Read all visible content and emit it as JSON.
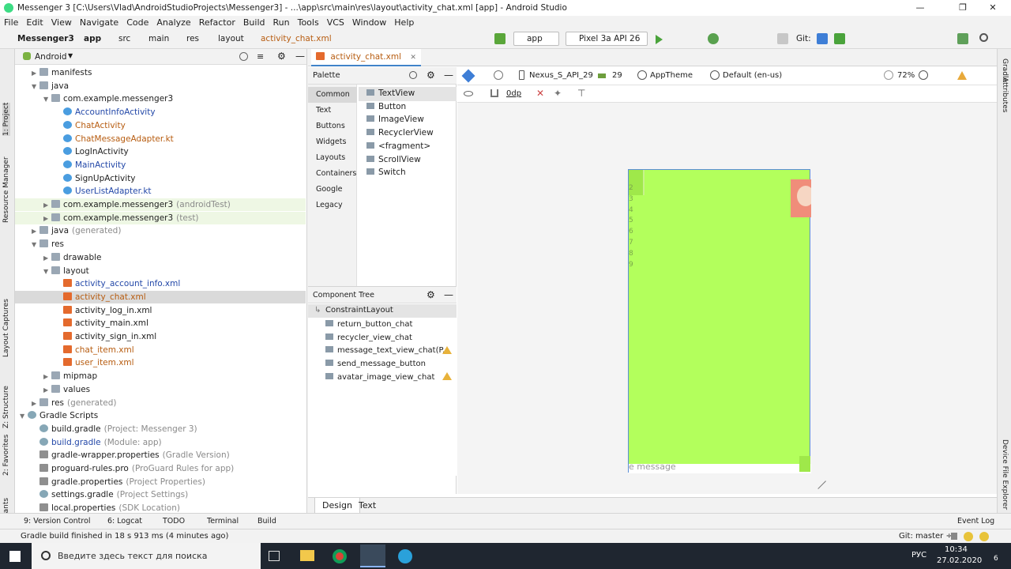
{
  "window": {
    "title": "Messenger 3 [C:\\Users\\Vlad\\AndroidStudioProjects\\Messenger3] - ...\\app\\src\\main\\res\\layout\\activity_chat.xml [app] - Android Studio",
    "minimize": "—",
    "maximize": "❐",
    "close": "✕"
  },
  "menu": [
    "File",
    "Edit",
    "View",
    "Navigate",
    "Code",
    "Analyze",
    "Refactor",
    "Build",
    "Run",
    "Tools",
    "VCS",
    "Window",
    "Help"
  ],
  "breadcrumbs": [
    "Messenger3",
    "app",
    "src",
    "main",
    "res",
    "layout",
    "activity_chat.xml"
  ],
  "toolbar": {
    "run_config": "app",
    "device": "Pixel 3a API 26",
    "git_label": "Git:"
  },
  "left_tabs": [
    "1: Project",
    "Resource Manager",
    "Layout Captures",
    "Z: Structure",
    "2: Favorites",
    "Build Variants"
  ],
  "project": {
    "view": "Android",
    "tree": [
      {
        "label": "manifests",
        "extra": "",
        "style": "normal",
        "icon": "folder-icon",
        "arrow": "▶"
      },
      {
        "label": "java",
        "extra": "",
        "style": "normal",
        "icon": "folder-icon",
        "arrow": "▼"
      },
      {
        "label": "com.example.messenger3",
        "extra": "",
        "style": "normal",
        "icon": "package-icon",
        "arrow": "▼"
      },
      {
        "label": "AccountInfoActivity",
        "extra": "",
        "style": "blue",
        "icon": "class-icon",
        "arrow": ""
      },
      {
        "label": "ChatActivity",
        "extra": "",
        "style": "orange",
        "icon": "class-icon",
        "arrow": ""
      },
      {
        "label": "ChatMessageAdapter.kt",
        "extra": "",
        "style": "orange",
        "icon": "kotlin-file-icon",
        "arrow": ""
      },
      {
        "label": "LogInActivity",
        "extra": "",
        "style": "normal",
        "icon": "class-icon",
        "arrow": ""
      },
      {
        "label": "MainActivity",
        "extra": "",
        "style": "blue",
        "icon": "class-icon",
        "arrow": ""
      },
      {
        "label": "SignUpActivity",
        "extra": "",
        "style": "normal",
        "icon": "class-icon",
        "arrow": ""
      },
      {
        "label": "UserListAdapter.kt",
        "extra": "",
        "style": "blue",
        "icon": "kotlin-file-icon",
        "arrow": ""
      },
      {
        "label": "com.example.messenger3",
        "extra": "(androidTest)",
        "style": "normal",
        "icon": "package-icon",
        "arrow": "▶"
      },
      {
        "label": "com.example.messenger3",
        "extra": "(test)",
        "style": "normal",
        "icon": "package-icon",
        "arrow": "▶"
      },
      {
        "label": "java",
        "extra": "(generated)",
        "style": "normal",
        "icon": "folder-icon",
        "arrow": "▶"
      },
      {
        "label": "res",
        "extra": "",
        "style": "normal",
        "icon": "folder-icon",
        "arrow": "▼"
      },
      {
        "label": "drawable",
        "extra": "",
        "style": "normal",
        "icon": "folder-icon",
        "arrow": "▶"
      },
      {
        "label": "layout",
        "extra": "",
        "style": "normal",
        "icon": "folder-icon",
        "arrow": "▼"
      },
      {
        "label": "activity_account_info.xml",
        "extra": "",
        "style": "blue",
        "icon": "xml-file-icon",
        "arrow": ""
      },
      {
        "label": "activity_chat.xml",
        "extra": "",
        "style": "orange",
        "icon": "xml-file-icon",
        "arrow": ""
      },
      {
        "label": "activity_log_in.xml",
        "extra": "",
        "style": "normal",
        "icon": "xml-file-icon",
        "arrow": ""
      },
      {
        "label": "activity_main.xml",
        "extra": "",
        "style": "normal",
        "icon": "xml-file-icon",
        "arrow": ""
      },
      {
        "label": "activity_sign_in.xml",
        "extra": "",
        "style": "normal",
        "icon": "xml-file-icon",
        "arrow": ""
      },
      {
        "label": "chat_item.xml",
        "extra": "",
        "style": "orange",
        "icon": "xml-file-icon",
        "arrow": ""
      },
      {
        "label": "user_item.xml",
        "extra": "",
        "style": "orange",
        "icon": "xml-file-icon",
        "arrow": ""
      },
      {
        "label": "mipmap",
        "extra": "",
        "style": "normal",
        "icon": "folder-icon",
        "arrow": "▶"
      },
      {
        "label": "values",
        "extra": "",
        "style": "normal",
        "icon": "folder-icon",
        "arrow": "▶"
      },
      {
        "label": "res",
        "extra": "(generated)",
        "style": "normal",
        "icon": "folder-icon",
        "arrow": "▶"
      },
      {
        "label": "Gradle Scripts",
        "extra": "",
        "style": "normal",
        "icon": "gradle-icon",
        "arrow": "▼"
      },
      {
        "label": "build.gradle",
        "extra": "(Project: Messenger 3)",
        "style": "normal",
        "icon": "gradle-icon",
        "arrow": ""
      },
      {
        "label": "build.gradle",
        "extra": "(Module: app)",
        "style": "blue",
        "icon": "gradle-icon",
        "arrow": ""
      },
      {
        "label": "gradle-wrapper.properties",
        "extra": "(Gradle Version)",
        "style": "normal",
        "icon": "properties-icon",
        "arrow": ""
      },
      {
        "label": "proguard-rules.pro",
        "extra": "(ProGuard Rules for app)",
        "style": "normal",
        "icon": "properties-icon",
        "arrow": ""
      },
      {
        "label": "gradle.properties",
        "extra": "(Project Properties)",
        "style": "normal",
        "icon": "properties-icon",
        "arrow": ""
      },
      {
        "label": "settings.gradle",
        "extra": "(Project Settings)",
        "style": "normal",
        "icon": "gradle-icon",
        "arrow": ""
      },
      {
        "label": "local.properties",
        "extra": "(SDK Location)",
        "style": "normal",
        "icon": "properties-icon",
        "arrow": ""
      }
    ]
  },
  "editor": {
    "tab": "activity_chat.xml",
    "bottom_tabs": [
      "Design",
      "Text"
    ]
  },
  "palette": {
    "title": "Palette",
    "categories": [
      "Common",
      "Text",
      "Buttons",
      "Widgets",
      "Layouts",
      "Containers",
      "Google",
      "Legacy"
    ],
    "items": [
      "TextView",
      "Button",
      "ImageView",
      "RecyclerView",
      "<fragment>",
      "ScrollView",
      "Switch"
    ]
  },
  "component_tree": {
    "title": "Component Tree",
    "root": "ConstraintLayout",
    "items": [
      "return_button_chat",
      "recycler_view_chat",
      "message_text_view_chat(P...",
      "send_message_button",
      "avatar_image_view_chat"
    ]
  },
  "design_toolbar": {
    "device": "Nexus_S_API_29",
    "api": "29",
    "theme": "AppTheme",
    "locale": "Default (en-us)",
    "zoom": "72%",
    "margin": "0dp"
  },
  "phone_preview": {
    "numbers": [
      "2",
      "3",
      "4",
      "5",
      "6",
      "7",
      "8",
      "9"
    ],
    "hint": "e message",
    "background": "#b3ff5c"
  },
  "right_tabs": [
    "Gradle",
    "Attributes",
    "Device File Explorer"
  ],
  "tool_windows": [
    "9: Version Control",
    "6: Logcat",
    "TODO",
    "Terminal",
    "Build"
  ],
  "event_log": "Event Log",
  "status": {
    "message": "Gradle build finished in 18 s 913 ms (4 minutes ago)",
    "git_branch": "Git: master ÷"
  },
  "taskbar": {
    "search_placeholder": "Введите здесь текст для поиска",
    "language": "РУС",
    "time": "10:34",
    "date": "27.02.2020",
    "notifications": "6"
  }
}
